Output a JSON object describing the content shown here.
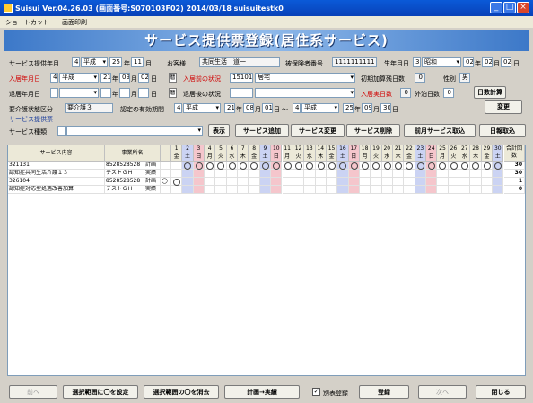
{
  "window": {
    "title": "Suisui Ver.04.26.03 (画面番号:S070103F02) 2014/03/18 suisuitestk0",
    "minimize": "_",
    "maximize": "□",
    "close": "×"
  },
  "menu": [
    "ショートカット",
    "画面印刷"
  ],
  "banner": "サービス提供票登録(居住系サービス)",
  "form": {
    "service_ym_label": "サービス提供年月",
    "era1": "平成",
    "year1": "25",
    "year1_unit": "年",
    "month1": "11",
    "month1_unit": "月",
    "customer_label": "お客様",
    "customer_value": "共同生活　道一",
    "insured_label": "被保険者番号",
    "insured_value": "1111111111",
    "birth_label": "生年月日",
    "birth_era_code": "3",
    "birth_era": "昭和",
    "birth_y": "02",
    "birth_y_unit": "年",
    "birth_m": "02",
    "birth_m_unit": "月",
    "birth_d": "02",
    "birth_d_unit": "日",
    "enter_label": "入居年月日",
    "enter_era": "平成",
    "enter_y": "21",
    "enter_y_unit": "年",
    "enter_m": "09",
    "enter_m_unit": "月",
    "enter_d": "02",
    "enter_d_unit": "日",
    "cal_label": "暦",
    "before_label": "入居前の状況",
    "before_code": "15101",
    "before_value": "居宅",
    "initial_label": "初期加算残日数",
    "initial_value": "0",
    "sex_label": "性別",
    "sex_value": "男",
    "leave_label": "退居年月日",
    "leave_y_unit": "年",
    "leave_m_unit": "月",
    "leave_d_unit": "日",
    "after_label": "退居後の状況",
    "stay_label": "入居実日数",
    "stay_value": "0",
    "out_label": "外泊日数",
    "out_value": "0",
    "days_calc": "日数計算",
    "care_label": "要介護状態区分",
    "care_value": "要介護３",
    "cert_label": "認定の有効期間",
    "cert_from_era": "平成",
    "cert_from_y": "21",
    "cert_from_m": "08",
    "cert_from_d": "01",
    "cert_y_unit": "年",
    "cert_m_unit": "月",
    "cert_d_unit": "日",
    "cert_sep": "～",
    "cert_to_code": "4",
    "cert_to_era": "平成",
    "cert_to_y": "25",
    "cert_to_m": "09",
    "cert_to_d": "30",
    "change": "変更",
    "era_code": "4"
  },
  "service_section": {
    "title": "サービス提供票",
    "type_label": "サービス種類",
    "show": "表示",
    "add": "サービス追加",
    "modify": "サービス変更",
    "delete": "サービス削除",
    "prev_month": "前月サービス取込",
    "daily": "日報取込"
  },
  "grid": {
    "headers": {
      "content": "サービス内容",
      "office": "事業所名",
      "total": "合計回数"
    },
    "days": [
      {
        "d": "1",
        "w": "金"
      },
      {
        "d": "2",
        "w": "土"
      },
      {
        "d": "3",
        "w": "日"
      },
      {
        "d": "4",
        "w": "月"
      },
      {
        "d": "5",
        "w": "火"
      },
      {
        "d": "6",
        "w": "水"
      },
      {
        "d": "7",
        "w": "木"
      },
      {
        "d": "8",
        "w": "金"
      },
      {
        "d": "9",
        "w": "土"
      },
      {
        "d": "10",
        "w": "日"
      },
      {
        "d": "11",
        "w": "月"
      },
      {
        "d": "12",
        "w": "火"
      },
      {
        "d": "13",
        "w": "水"
      },
      {
        "d": "14",
        "w": "木"
      },
      {
        "d": "15",
        "w": "金"
      },
      {
        "d": "16",
        "w": "土"
      },
      {
        "d": "17",
        "w": "日"
      },
      {
        "d": "18",
        "w": "月"
      },
      {
        "d": "19",
        "w": "火"
      },
      {
        "d": "20",
        "w": "水"
      },
      {
        "d": "21",
        "w": "木"
      },
      {
        "d": "22",
        "w": "金"
      },
      {
        "d": "23",
        "w": "土"
      },
      {
        "d": "24",
        "w": "日"
      },
      {
        "d": "25",
        "w": "月"
      },
      {
        "d": "26",
        "w": "火"
      },
      {
        "d": "27",
        "w": "水"
      },
      {
        "d": "28",
        "w": "木"
      },
      {
        "d": "29",
        "w": "金"
      },
      {
        "d": "30",
        "w": "土"
      }
    ],
    "rows": [
      {
        "code": "321131",
        "name": "認知症共同生活介護１３",
        "office_code": "8528528528",
        "office": "テストＧＨ",
        "plan": "計画",
        "actual": "実績",
        "plan_days": "2-30",
        "actual_days": "",
        "plan_total": "30",
        "actual_total": "30"
      },
      {
        "code": "326104",
        "name": "認知症対応型処遇改善加算",
        "office_code": "8528528528",
        "office": "テストＧＨ",
        "plan": "計画",
        "actual": "実績",
        "plan_days": "1",
        "actual_days": "",
        "plan_total": "1",
        "actual_total": "0"
      }
    ]
  },
  "footer": {
    "prev": "前へ",
    "set_circle": "選択範囲に〇を設定",
    "clear_circle": "選択範囲の〇を消去",
    "plan_to_actual": "計画→実績",
    "separate": "別表登録",
    "register": "登録",
    "next": "次へ",
    "close": "閉じる"
  }
}
